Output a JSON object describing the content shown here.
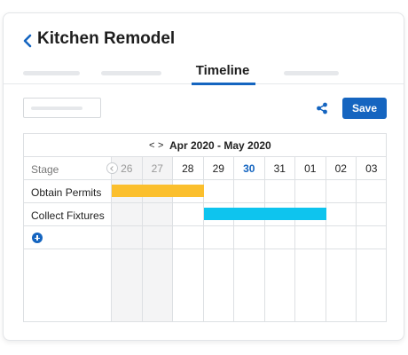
{
  "header": {
    "title": "Kitchen Remodel",
    "tabs": [
      {
        "label": ""
      },
      {
        "label": ""
      },
      {
        "label": "Timeline",
        "active": true
      },
      {
        "label": ""
      }
    ]
  },
  "toolbar": {
    "search_placeholder": "",
    "save_label": "Save",
    "share_icon": "share-icon"
  },
  "gantt": {
    "range_label": "Apr 2020 - May 2020",
    "prev_symbol": "<",
    "next_symbol": ">",
    "stage_header": "Stage",
    "days": [
      "26",
      "27",
      "28",
      "29",
      "30",
      "31",
      "01",
      "02",
      "03"
    ],
    "past_days": [
      "26",
      "27"
    ],
    "today": "30",
    "stages": [
      {
        "name": "Obtain Permits",
        "start_day": "26",
        "end_day": "28",
        "color": "#fbbf2d"
      },
      {
        "name": "Collect Fixtures",
        "start_day": "29",
        "end_day": "01",
        "color": "#0ec4ee"
      }
    ]
  },
  "colors": {
    "accent": "#1565c0"
  }
}
